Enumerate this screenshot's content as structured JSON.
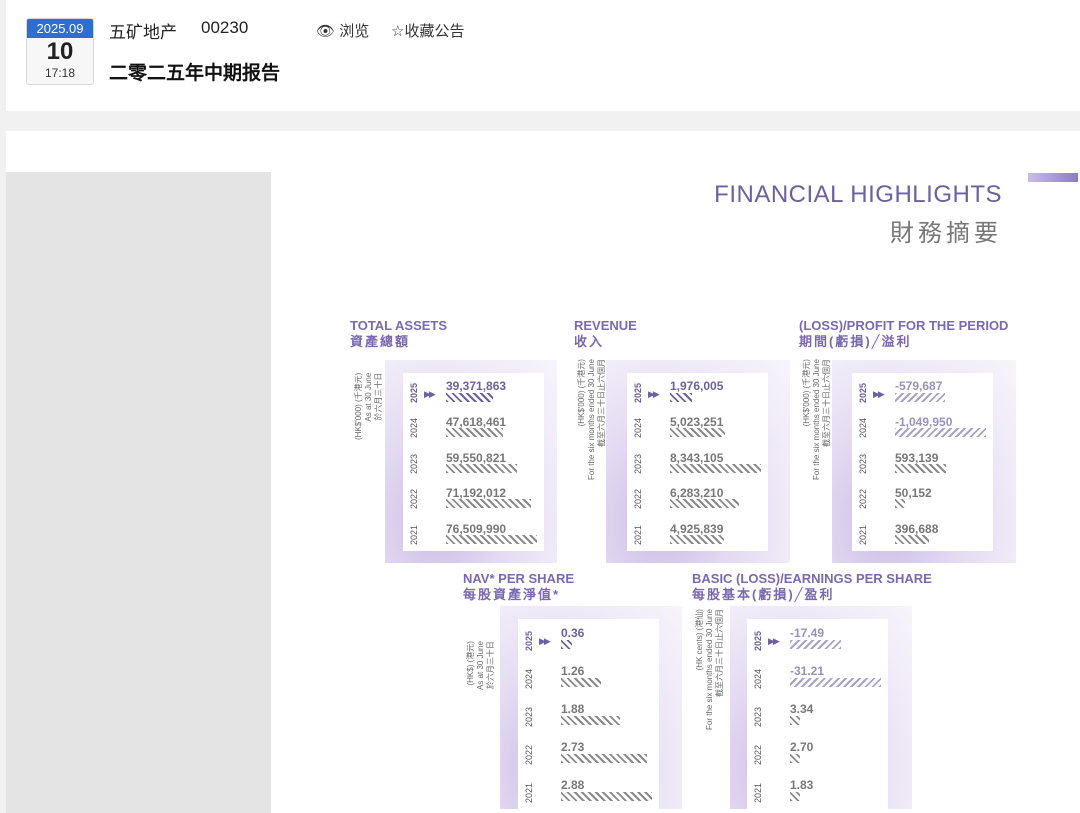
{
  "header": {
    "date_ym": "2025.09",
    "date_day": "10",
    "date_time": "17:18",
    "company": "五矿地产",
    "code": "00230",
    "views_label": "浏览",
    "favorite_label": "收藏公告",
    "report_title": "二零二五年中期报告"
  },
  "page": {
    "title_en": "FINANCIAL HIGHLIGHTS",
    "title_zh": "財務摘要"
  },
  "colors": {
    "accent": "#6e5fa0",
    "grey_bar": "#8a8a8a",
    "neg_bar": "#a9a2c8"
  },
  "chart_data": [
    {
      "type": "bar",
      "title": "TOTAL ASSETS",
      "title_zh": "資產總額",
      "unit_lines": [
        "(HK$'000) (千港元)",
        "As at 30 June",
        "於六月三十日"
      ],
      "categories": [
        "2025",
        "2024",
        "2023",
        "2022",
        "2021"
      ],
      "values": [
        39371863,
        47618461,
        59550821,
        71192012,
        76509990
      ],
      "labels": [
        "39,371,863",
        "47,618,461",
        "59,550,821",
        "71,192,012",
        "76,509,990"
      ]
    },
    {
      "type": "bar",
      "title": "REVENUE",
      "title_zh": "收入",
      "unit_lines": [
        "(HK$'000) (千港元)",
        "For the six months ended 30 June",
        "截至六月三十日止六個月"
      ],
      "categories": [
        "2025",
        "2024",
        "2023",
        "2022",
        "2021"
      ],
      "values": [
        1976005,
        5023251,
        8343105,
        6283210,
        4925839
      ],
      "labels": [
        "1,976,005",
        "5,023,251",
        "8,343,105",
        "6,283,210",
        "4,925,839"
      ]
    },
    {
      "type": "bar",
      "title": "(LOSS)/PROFIT FOR THE PERIOD",
      "title_zh": "期間(虧損)╱溢利",
      "unit_lines": [
        "(HK$'000) (千港元)",
        "For the six months ended 30 June",
        "截至六月三十日止六個月"
      ],
      "categories": [
        "2025",
        "2024",
        "2023",
        "2022",
        "2021"
      ],
      "values": [
        -579687,
        -1049950,
        593139,
        50152,
        396688
      ],
      "labels": [
        "-579,687",
        "-1,049,950",
        "593,139",
        "50,152",
        "396,688"
      ]
    },
    {
      "type": "bar",
      "title": "NAV* PER SHARE",
      "title_zh": "每股資產淨值*",
      "unit_lines": [
        "(HK$) (港元)",
        "As at 30 June",
        "於六月三十日"
      ],
      "categories": [
        "2025",
        "2024",
        "2023",
        "2022",
        "2021"
      ],
      "values": [
        0.36,
        1.26,
        1.88,
        2.73,
        2.88
      ],
      "labels": [
        "0.36",
        "1.26",
        "1.88",
        "2.73",
        "2.88"
      ]
    },
    {
      "type": "bar",
      "title": "BASIC (LOSS)/EARNINGS PER SHARE",
      "title_zh": "每股基本(虧損)╱盈利",
      "unit_lines": [
        "(HK cents) (港仙)",
        "For the six months ended 30 June",
        "截至六月三十日止六個月"
      ],
      "categories": [
        "2025",
        "2024",
        "2023",
        "2022",
        "2021"
      ],
      "values": [
        -17.49,
        -31.21,
        3.34,
        2.7,
        1.83
      ],
      "labels": [
        "-17.49",
        "-31.21",
        "3.34",
        "2.70",
        "1.83"
      ]
    }
  ]
}
